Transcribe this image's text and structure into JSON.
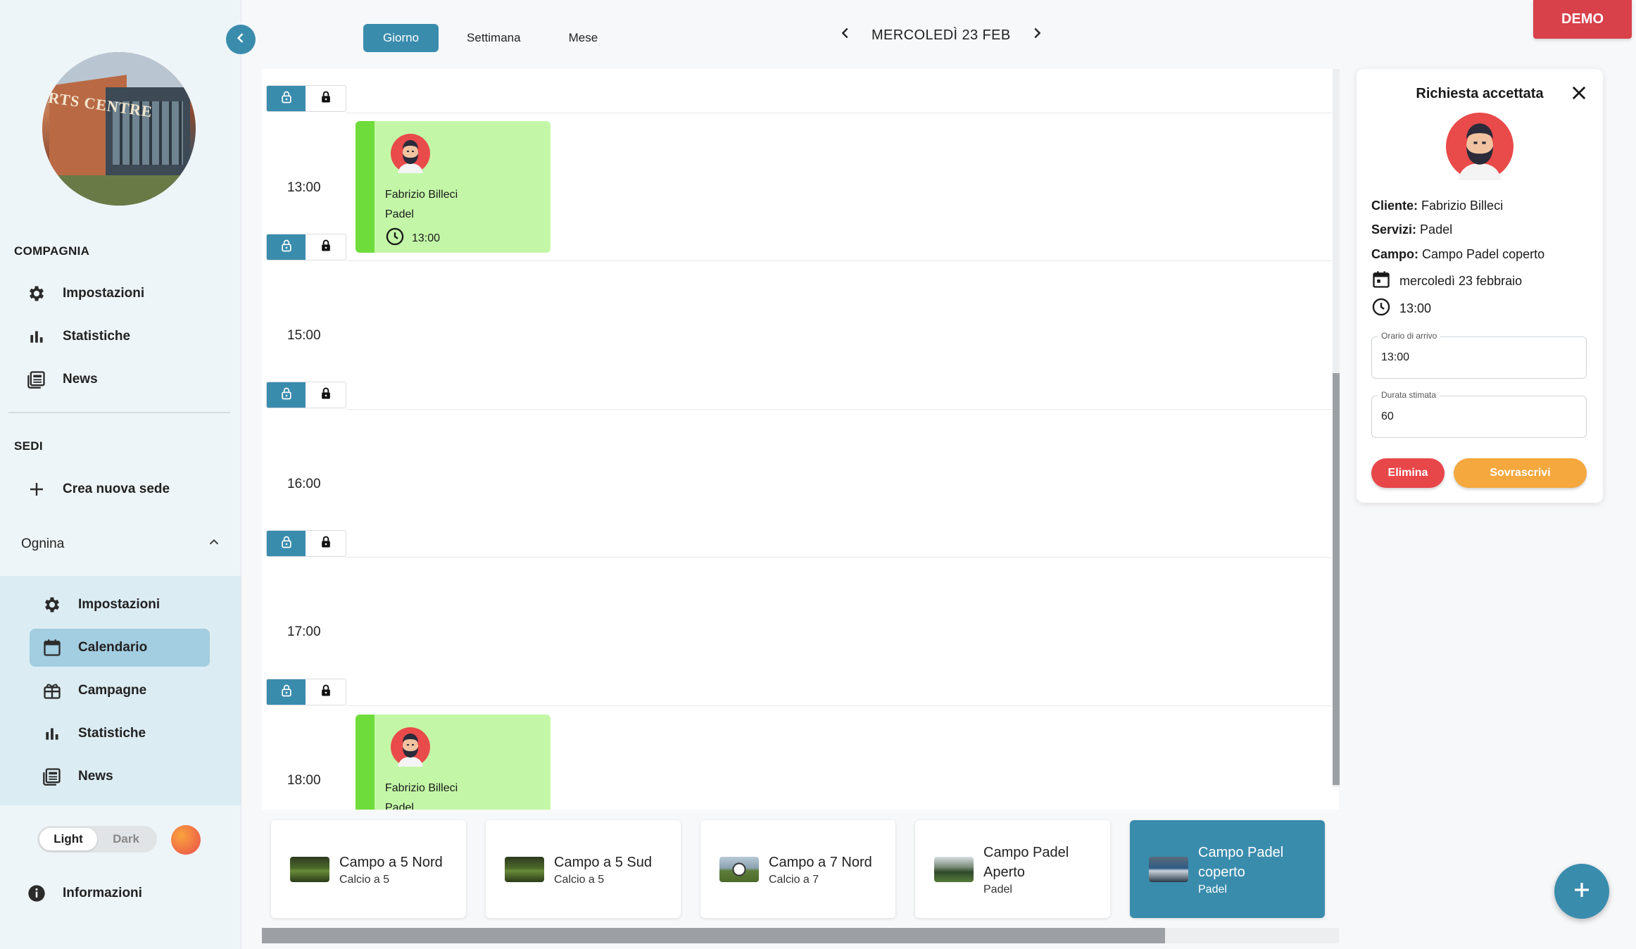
{
  "sidebar": {
    "venue_photo_sign": "RTS CENTRE",
    "company_section": "COMPAGNIA",
    "company_items": [
      {
        "label": "Impostazioni",
        "icon": "gear-icon"
      },
      {
        "label": "Statistiche",
        "icon": "bar-chart-icon"
      },
      {
        "label": "News",
        "icon": "newspaper-icon"
      }
    ],
    "sedi_section": "SEDI",
    "create_site_label": "Crea nuova sede",
    "site_name": "Ognina",
    "site_items": [
      {
        "label": "Impostazioni",
        "icon": "gear-icon"
      },
      {
        "label": "Calendario",
        "icon": "calendar-icon",
        "active": true
      },
      {
        "label": "Campagne",
        "icon": "gift-icon"
      },
      {
        "label": "Statistiche",
        "icon": "bar-chart-icon"
      },
      {
        "label": "News",
        "icon": "newspaper-icon"
      }
    ],
    "theme_toggle": {
      "light": "Light",
      "dark": "Dark",
      "selected": "Light"
    },
    "info_label": "Informazioni"
  },
  "topbar": {
    "view_tabs": [
      "Giorno",
      "Settimana",
      "Mese"
    ],
    "selected_view": "Giorno",
    "current_date": "MERCOLEDÌ 23 FEB",
    "demo_label": "DEMO"
  },
  "calendar": {
    "time_labels": [
      "13:00",
      "15:00",
      "16:00",
      "17:00",
      "18:00"
    ],
    "events": [
      {
        "name": "Fabrizio Billeci",
        "service": "Padel",
        "time": "13:00"
      },
      {
        "name": "Fabrizio Billeci",
        "service": "Padel"
      }
    ]
  },
  "courts": [
    {
      "name": "Campo a 5 Nord",
      "type": "Calcio a 5",
      "selected": false
    },
    {
      "name": "Campo a 5 Sud",
      "type": "Calcio a 5",
      "selected": false
    },
    {
      "name": "Campo a 7 Nord",
      "type": "Calcio a 7",
      "selected": false
    },
    {
      "name": "Campo Padel Aperto",
      "type": "Padel",
      "selected": false
    },
    {
      "name": "Campo Padel coperto",
      "type": "Padel",
      "selected": true
    }
  ],
  "detail": {
    "title": "Richiesta accettata",
    "cliente_label": "Cliente:",
    "cliente": "Fabrizio Billeci",
    "servizi_label": "Servizi:",
    "servizi": "Padel",
    "campo_label": "Campo:",
    "campo": "Campo Padel coperto",
    "date": "mercoledì 23 febbraio",
    "time": "13:00",
    "arrival_label": "Orario di arrivo",
    "arrival_value": "13:00",
    "duration_label": "Durata stimata",
    "duration_value": "60",
    "delete_label": "Elimina",
    "overwrite_label": "Sovrascrivi"
  },
  "colors": {
    "accent": "#3a8cad",
    "event_bg": "#c3f7a7",
    "event_bar": "#6edc3b",
    "demo": "#d8404a",
    "delete": "#e8474a",
    "overwrite": "#f4a83e"
  }
}
